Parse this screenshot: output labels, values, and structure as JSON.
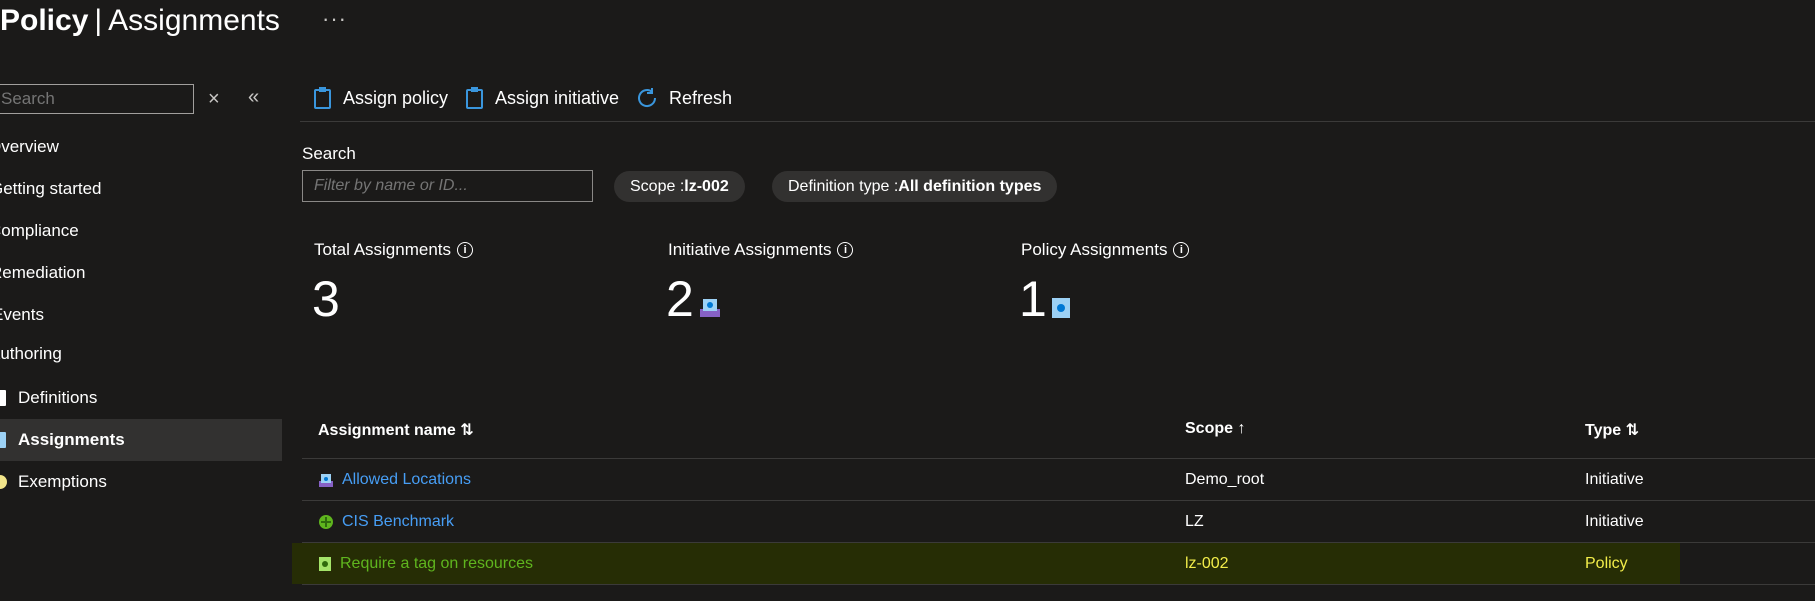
{
  "header": {
    "title_bold": "Policy",
    "title_sep": "|",
    "title_light": "Assignments",
    "more": "···"
  },
  "sidebar": {
    "search_placeholder": "Search",
    "items": [
      {
        "label": "Overview"
      },
      {
        "label": "Getting started"
      },
      {
        "label": "Compliance"
      },
      {
        "label": "Remediation"
      },
      {
        "label": "Events"
      },
      {
        "label": "Authoring"
      }
    ],
    "sub_items": [
      {
        "label": "Definitions",
        "icon": "definitions-icon"
      },
      {
        "label": "Assignments",
        "icon": "assignments-icon",
        "selected": true
      },
      {
        "label": "Exemptions",
        "icon": "exemptions-icon"
      }
    ]
  },
  "toolbar": {
    "assign_policy": "Assign policy",
    "assign_initiative": "Assign initiative",
    "refresh": "Refresh"
  },
  "filters": {
    "search_label": "Search",
    "search_placeholder": "Filter by name or ID...",
    "scope_label": "Scope : ",
    "scope_value": "lz-002",
    "deftype_label": "Definition type : ",
    "deftype_value": "All definition types"
  },
  "stats": {
    "total_label": "Total Assignments",
    "total_value": "3",
    "initiative_label": "Initiative Assignments",
    "initiative_value": "2",
    "policy_label": "Policy Assignments",
    "policy_value": "1"
  },
  "table": {
    "columns": [
      "Assignment name ⇅",
      "Scope ↑",
      "Type ⇅"
    ],
    "rows": [
      {
        "name": "Allowed Locations",
        "scope": "Demo_root",
        "type": "Initiative",
        "icon": "initiative-icon"
      },
      {
        "name": "CIS Benchmark",
        "scope": "LZ",
        "type": "Initiative",
        "icon": "benchmark-icon"
      },
      {
        "name": "Require a tag on resources",
        "scope": "lz-002",
        "type": "Policy",
        "icon": "policy-icon",
        "highlighted": true
      }
    ]
  },
  "colors": {
    "background": "#1b1a19",
    "link": "#479ef5",
    "highlight_row": "#262d05",
    "highlight_name": "#5fb51e",
    "highlight_text": "#f2ed4a",
    "selected_nav": "#323130"
  }
}
